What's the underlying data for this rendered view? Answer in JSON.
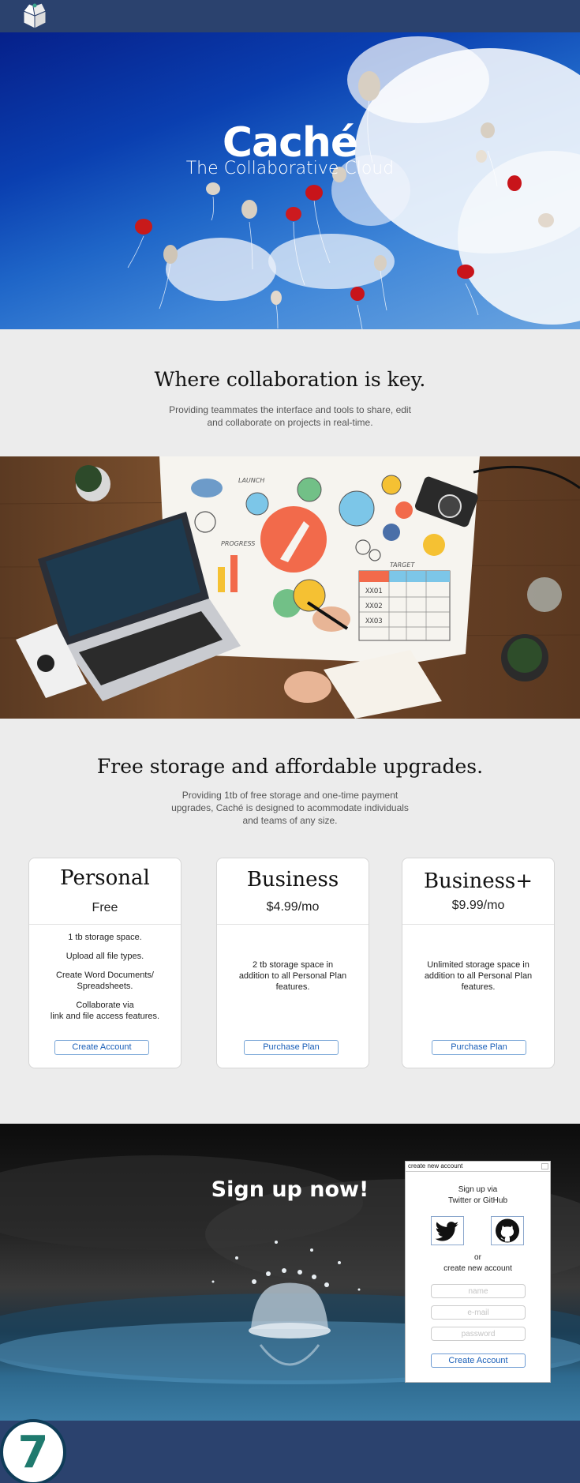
{
  "nav": {
    "logo_icon": "box-icon"
  },
  "hero": {
    "title": "Caché",
    "subtitle": "The Collaborative Cloud"
  },
  "intro": {
    "heading": "Where collaboration is key.",
    "lines": [
      "Providing teammates the interface and tools to share, edit",
      "and collaborate on projects in real-time."
    ]
  },
  "desk_image": {
    "labels": {
      "launch": "LAUNCH",
      "progress": "PROGRESS",
      "target": "TARGET"
    },
    "table_rows": [
      "XXO1",
      "XXO2",
      "XXO3"
    ]
  },
  "pricing": {
    "heading": "Free storage and affordable upgrades.",
    "lines": [
      "Providing 1tb of free storage and one-time payment",
      "upgrades, Caché is designed to acommodate individuals",
      "and teams of any size."
    ],
    "plans": [
      {
        "name": "Personal",
        "price": "Free",
        "features": [
          "1 tb storage space.",
          "Upload all file types.",
          "Create Word Documents/\nSpreadsheets.",
          "Collaborate via\nlink and file access features."
        ],
        "button": "Create Account"
      },
      {
        "name": "Business",
        "price": "$4.99/mo",
        "features": [
          "2 tb storage space in\naddition to all Personal Plan\nfeatures."
        ],
        "button": "Purchase Plan"
      },
      {
        "name": "Business+",
        "price": "$9.99/mo",
        "features": [
          "Unlimited storage space in\naddition to all Personal Plan\nfeatures."
        ],
        "button": "Purchase Plan"
      }
    ]
  },
  "signup": {
    "heading": "Sign up now!",
    "panel_title": "create new account",
    "via_line1": "Sign up via",
    "via_line2": "Twitter or GitHub",
    "or_line1": "or",
    "or_line2": "create new account",
    "name_placeholder": "name",
    "email_placeholder": "e-mail",
    "password_placeholder": "password",
    "button": "Create Account"
  },
  "footer": {
    "badge": "7"
  },
  "colors": {
    "nav": "#2b426e",
    "accent": "#1a5fb8",
    "badge_text": "#1f7a6e"
  }
}
